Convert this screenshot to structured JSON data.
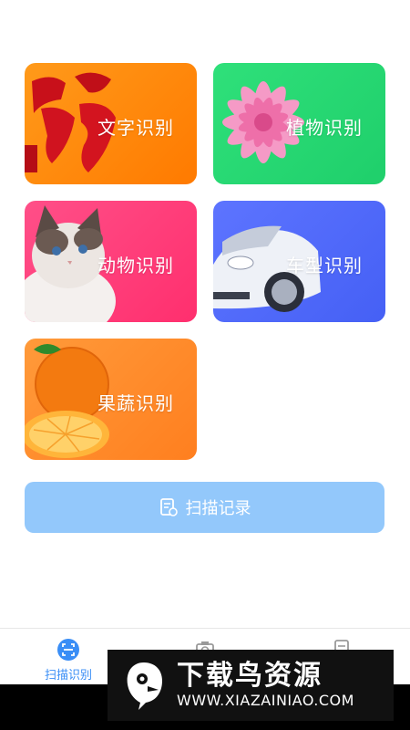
{
  "cards": {
    "text": {
      "label": "文字识别",
      "art": "fu-calligraphy-image"
    },
    "plant": {
      "label": "植物识别",
      "art": "pink-dahlia-image"
    },
    "animal": {
      "label": "动物识别",
      "art": "ragdoll-cat-image"
    },
    "car": {
      "label": "车型识别",
      "art": "white-sports-car-image"
    },
    "fruit": {
      "label": "果蔬识别",
      "art": "orange-fruit-image"
    }
  },
  "scan_record_button": {
    "label": "扫描记录",
    "icon": "document-list-icon"
  },
  "bottom_nav": {
    "items": [
      {
        "label": "扫描识别",
        "icon": "scan-icon",
        "active": true
      },
      {
        "label": "",
        "icon": "camera-icon"
      },
      {
        "label": "",
        "icon": "record-icon"
      }
    ]
  },
  "watermark": {
    "title": "下载鸟资源",
    "url": "WWW.XIAZAINIAO.COM"
  },
  "colors": {
    "accent": "#3a8ef6",
    "text_card": "#ff8a00",
    "plant_card": "#25d572",
    "animal_card": "#ff3a78",
    "car_card": "#4f68f8",
    "fruit_card": "#ff8c2a",
    "scan_button": "#93c8fb"
  }
}
